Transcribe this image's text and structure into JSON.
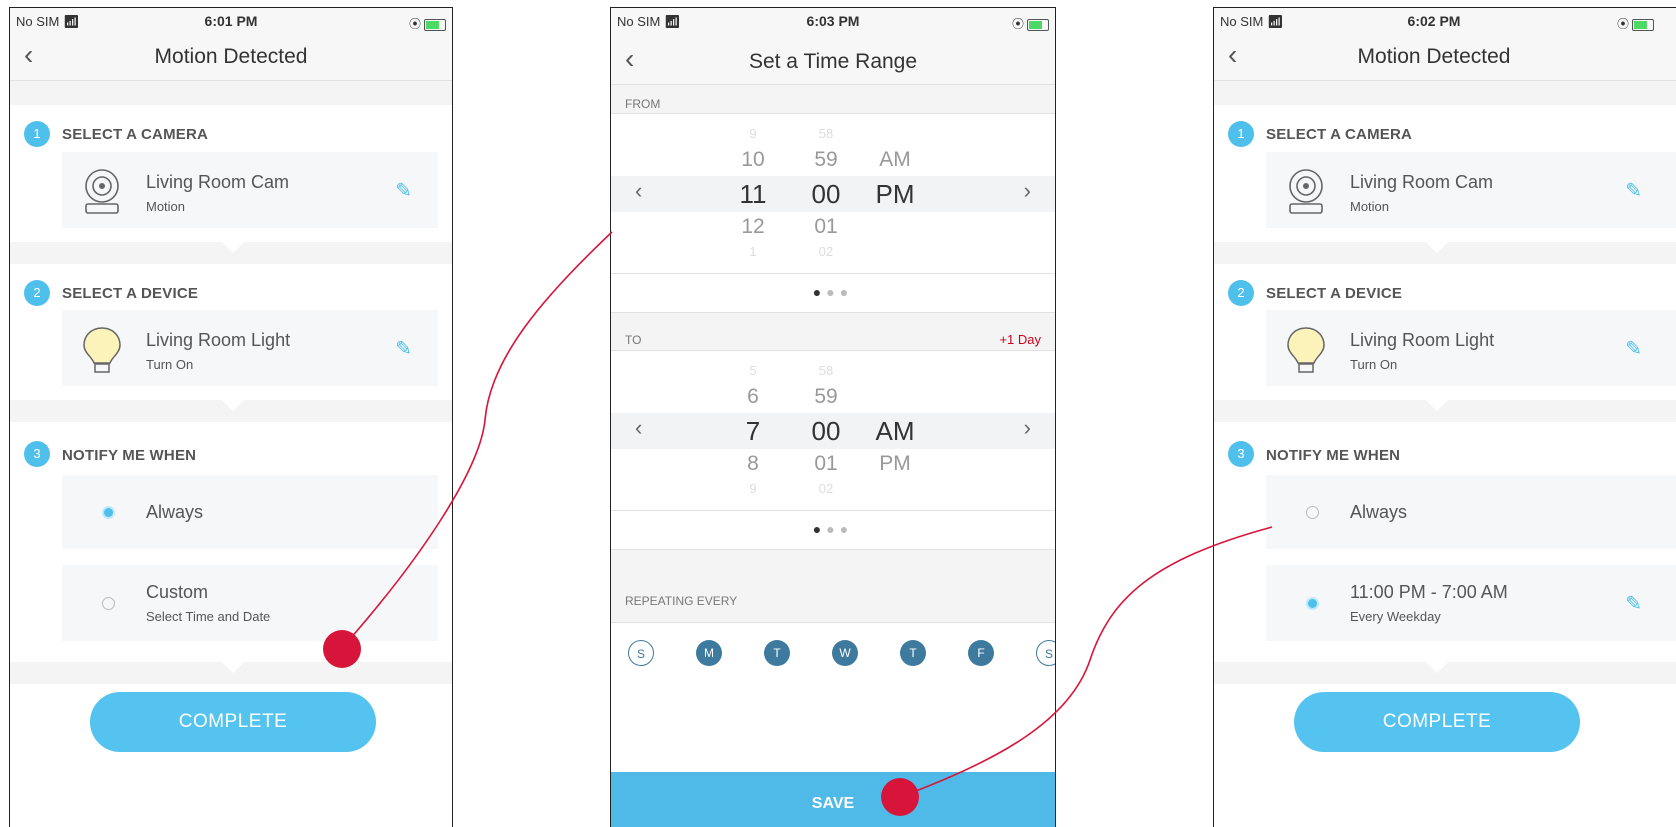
{
  "status_bar": {
    "carrier": "No SIM",
    "times": [
      "6:01 PM",
      "6:03 PM",
      "6:02 PM"
    ]
  },
  "screen1": {
    "title": "Motion Detected",
    "steps": [
      {
        "num": "1",
        "title": "SELECT A CAMERA",
        "name": "Living Room Cam",
        "sub": "Motion"
      },
      {
        "num": "2",
        "title": "SELECT A DEVICE",
        "name": "Living Room Light",
        "sub": "Turn On"
      },
      {
        "num": "3",
        "title": "NOTIFY ME WHEN"
      }
    ],
    "options": [
      {
        "label": "Always",
        "selected": true
      },
      {
        "label": "Custom",
        "sub": "Select Time and Date",
        "selected": false
      }
    ],
    "complete": "COMPLETE"
  },
  "screen2": {
    "title": "Set a Time Range",
    "from_label": "FROM",
    "from": {
      "hours": [
        "9",
        "10",
        "11",
        "12",
        "1"
      ],
      "minutes": [
        "58",
        "59",
        "00",
        "01",
        "02"
      ],
      "ampm": [
        "AM",
        "PM"
      ]
    },
    "to_label": "TO",
    "plus_day": "+1 Day",
    "to": {
      "hours": [
        "5",
        "6",
        "7",
        "8",
        "9"
      ],
      "minutes": [
        "58",
        "59",
        "00",
        "01",
        "02"
      ],
      "ampm": [
        "AM",
        "PM"
      ]
    },
    "repeat_label": "REPEATING EVERY",
    "days": [
      {
        "letter": "S",
        "on": false
      },
      {
        "letter": "M",
        "on": true
      },
      {
        "letter": "T",
        "on": true
      },
      {
        "letter": "W",
        "on": true
      },
      {
        "letter": "T",
        "on": true
      },
      {
        "letter": "F",
        "on": true
      },
      {
        "letter": "S",
        "on": false
      }
    ],
    "save": "SAVE"
  },
  "screen3": {
    "title": "Motion Detected",
    "steps": [
      {
        "num": "1",
        "title": "SELECT A CAMERA",
        "name": "Living Room Cam",
        "sub": "Motion"
      },
      {
        "num": "2",
        "title": "SELECT A DEVICE",
        "name": "Living Room Light",
        "sub": "Turn On"
      },
      {
        "num": "3",
        "title": "NOTIFY ME WHEN"
      }
    ],
    "options": [
      {
        "label": "Always",
        "selected": false
      },
      {
        "label": "11:00 PM - 7:00 AM",
        "sub": "Every Weekday",
        "selected": true
      }
    ],
    "complete": "COMPLETE"
  },
  "colors": {
    "accent": "#4fc0ec",
    "day_blue": "#3d7a9e",
    "annotation_red": "#d7153a"
  },
  "icons": [
    "chevron-left-icon",
    "wifi-icon",
    "battery-icon",
    "camera-icon",
    "light-bulb-icon",
    "pencil-icon",
    "chevron-right-icon"
  ]
}
